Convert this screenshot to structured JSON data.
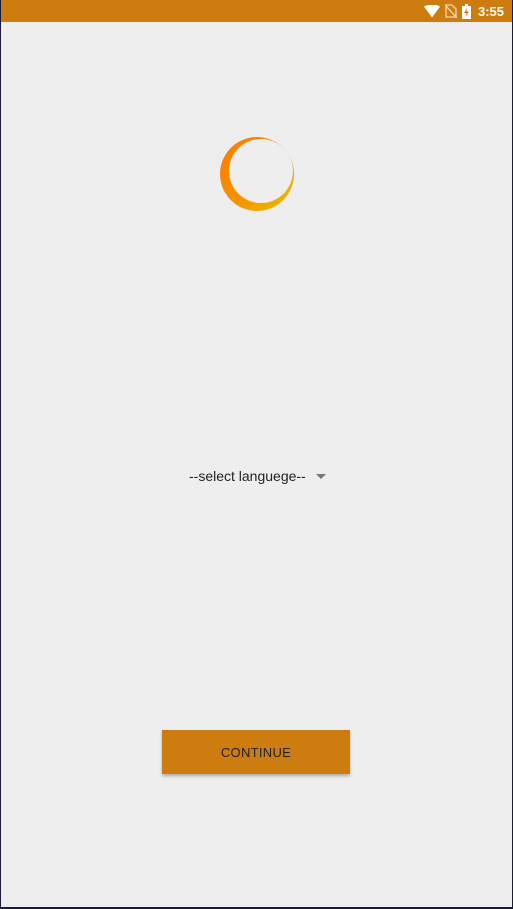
{
  "status_bar": {
    "time": "3:55",
    "icons": [
      "wifi-icon",
      "no-sim-icon",
      "battery-charging-icon"
    ],
    "color": "#cd7d10"
  },
  "logo": {
    "icon": "crescent-logo-icon",
    "colors": [
      "#ff7a00",
      "#e8c000"
    ]
  },
  "language_select": {
    "selected": "--select languege--",
    "icon": "dropdown-arrow-icon"
  },
  "continue_button": {
    "label": "CONTINUE",
    "color": "#cd7d10"
  }
}
